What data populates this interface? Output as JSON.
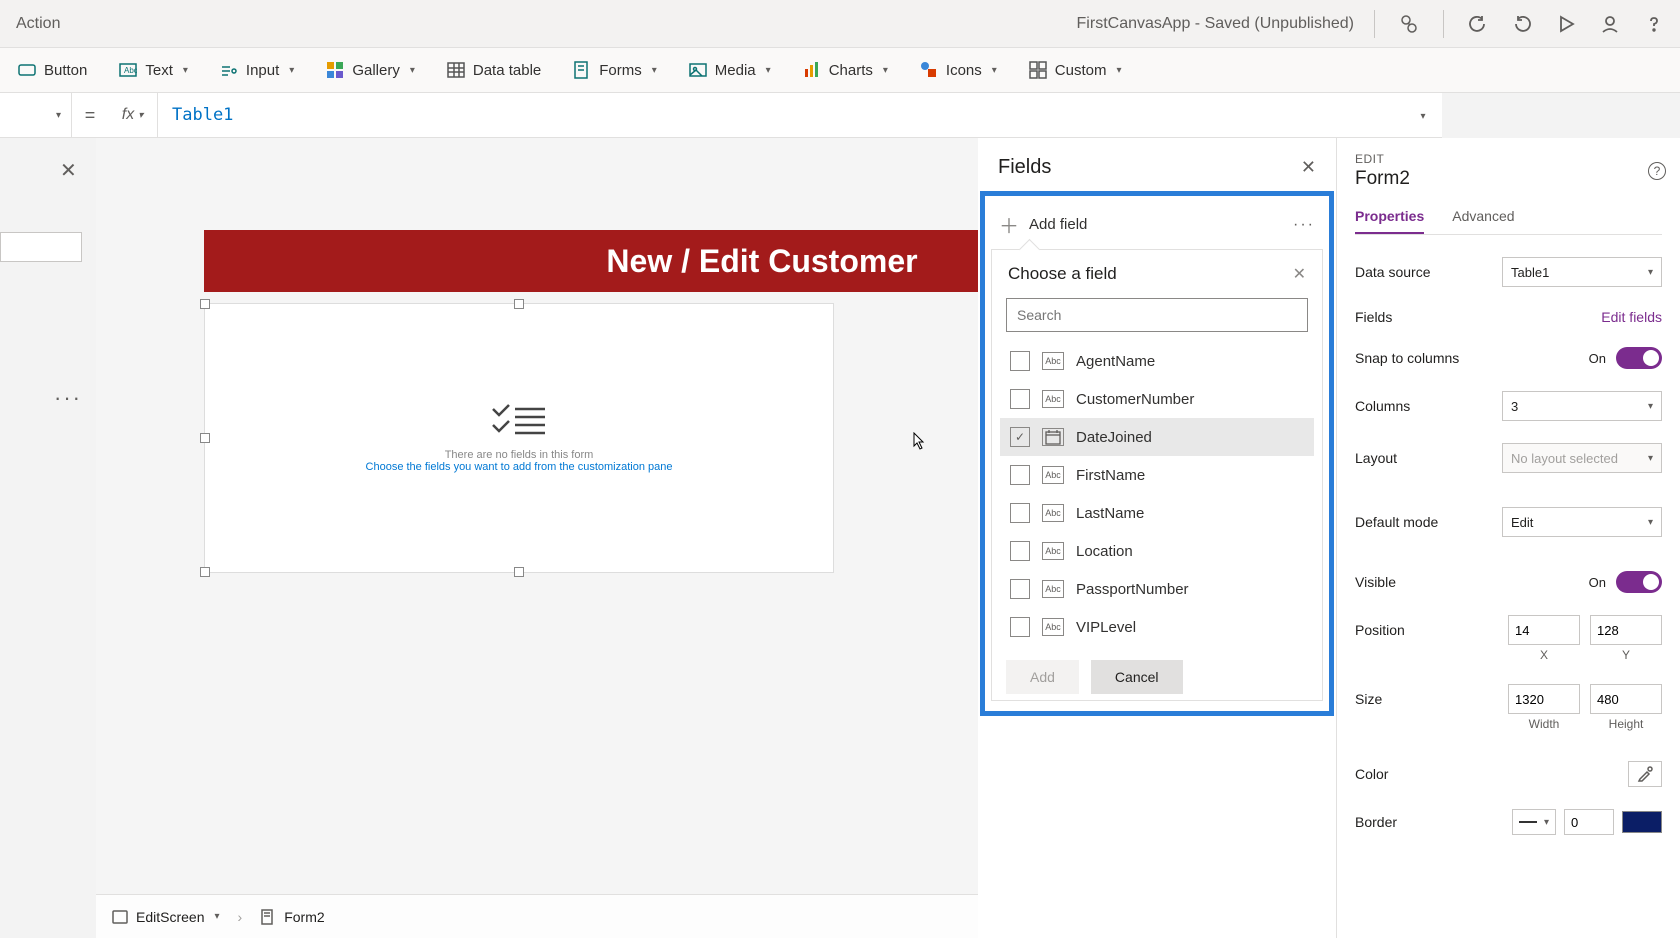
{
  "titlebar": {
    "action": "Action",
    "title": "FirstCanvasApp - Saved (Unpublished)"
  },
  "ribbon": {
    "button": "Button",
    "text": "Text",
    "input": "Input",
    "gallery": "Gallery",
    "datatable": "Data table",
    "forms": "Forms",
    "media": "Media",
    "charts": "Charts",
    "icons": "Icons",
    "custom": "Custom"
  },
  "formula": {
    "value": "Table1"
  },
  "canvas": {
    "formTitle": "New / Edit Customer",
    "emptyLine1": "There are no fields in this form",
    "emptyLine2": "Choose the fields you want to add from the customization pane"
  },
  "fieldsPanel": {
    "title": "Fields",
    "addField": "Add field",
    "chooseTitle": "Choose a field",
    "searchPlaceholder": "Search",
    "items": [
      {
        "name": "AgentName",
        "type": "text",
        "checked": false
      },
      {
        "name": "CustomerNumber",
        "type": "text",
        "checked": false
      },
      {
        "name": "DateJoined",
        "type": "date",
        "checked": true,
        "hover": true
      },
      {
        "name": "FirstName",
        "type": "text",
        "checked": false
      },
      {
        "name": "LastName",
        "type": "text",
        "checked": false
      },
      {
        "name": "Location",
        "type": "text",
        "checked": false
      },
      {
        "name": "PassportNumber",
        "type": "text",
        "checked": false
      },
      {
        "name": "VIPLevel",
        "type": "text",
        "checked": false
      }
    ],
    "addBtn": "Add",
    "cancelBtn": "Cancel"
  },
  "rightPanel": {
    "editLabel": "EDIT",
    "formName": "Form2",
    "tabs": {
      "properties": "Properties",
      "advanced": "Advanced"
    },
    "dataSourceLabel": "Data source",
    "dataSourceValue": "Table1",
    "fieldsLabel": "Fields",
    "editFields": "Edit fields",
    "snapLabel": "Snap to columns",
    "snapValue": "On",
    "columnsLabel": "Columns",
    "columnsValue": "3",
    "layoutLabel": "Layout",
    "layoutValue": "No layout selected",
    "defaultModeLabel": "Default mode",
    "defaultModeValue": "Edit",
    "visibleLabel": "Visible",
    "visibleValue": "On",
    "positionLabel": "Position",
    "posX": "14",
    "posY": "128",
    "xLabel": "X",
    "yLabel": "Y",
    "sizeLabel": "Size",
    "sizeW": "1320",
    "sizeH": "480",
    "wLabel": "Width",
    "hLabel": "Height",
    "colorLabel": "Color",
    "borderLabel": "Border",
    "borderWidth": "0"
  },
  "breadcrumb": {
    "editScreen": "EditScreen",
    "form": "Form2"
  }
}
